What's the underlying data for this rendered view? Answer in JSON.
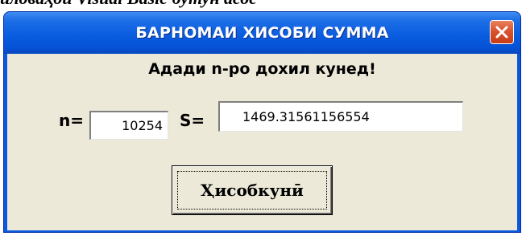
{
  "document": {
    "caption": "иловаҳои Visual Basic  бутун асос"
  },
  "window": {
    "title": "БАРНОМАИ ХИСОБИ СУММА",
    "close_icon": "close-icon"
  },
  "form": {
    "prompt": "Адади n-ро дохил кунед!",
    "n_label": "n=",
    "n_value": "10254",
    "s_label": "S=",
    "s_value": "1469.31561156554",
    "calculate_label": "Ҳисобкунӣ"
  },
  "colors": {
    "titlebar": "#0a5de0",
    "client": "#ece9d8",
    "close_button": "#d8532c"
  }
}
